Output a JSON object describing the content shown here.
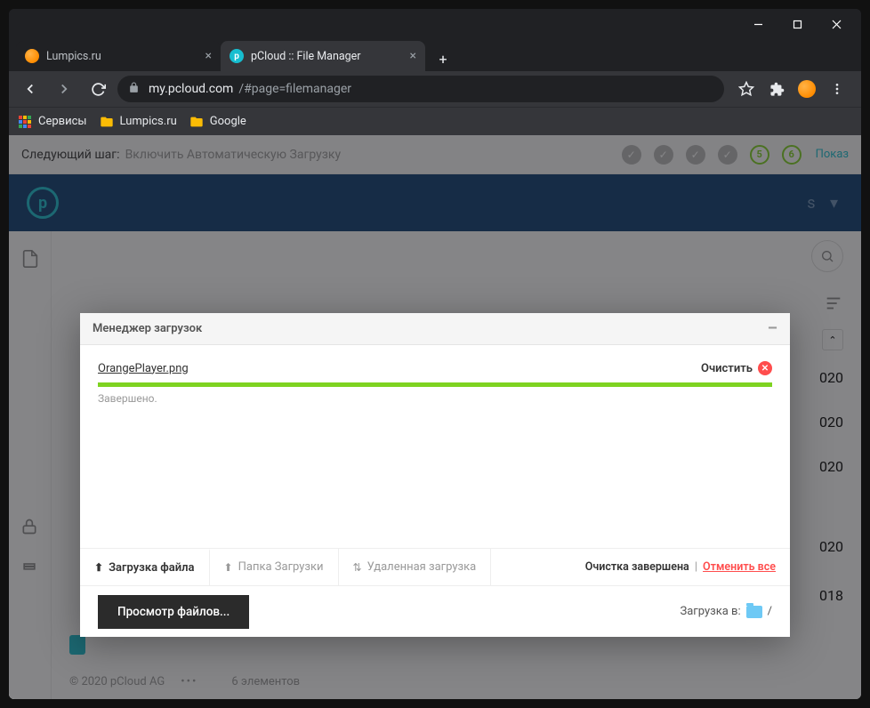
{
  "tabs": [
    {
      "title": "Lumpics.ru",
      "active": false,
      "favicon": "#ff8c00"
    },
    {
      "title": "pCloud :: File Manager",
      "active": true,
      "favicon": "#17bed0"
    }
  ],
  "url": {
    "host": "my.pcloud.com",
    "path": "/#page=filemanager"
  },
  "bookmarks": [
    {
      "label": "Сервисы",
      "type": "apps"
    },
    {
      "label": "Lumpics.ru",
      "type": "folder"
    },
    {
      "label": "Google",
      "type": "folder"
    }
  ],
  "banner": {
    "prefix": "Следующий шаг:",
    "hint": "Включить Автоматическую Загрузку",
    "step5": "5",
    "step6": "6",
    "show": "Показ"
  },
  "modal": {
    "title": "Менеджер загрузок",
    "file": "OrangePlayer.png",
    "clear": "Очистить",
    "status": "Завершено.",
    "tabs": {
      "upload_file": "Загрузка файла",
      "upload_folder": "Папка Загрузки",
      "remote_upload": "Удаленная загрузка"
    },
    "footer_status": {
      "done": "Очистка завершена",
      "cancel_all": "Отменить все"
    },
    "browse": "Просмотр файлов...",
    "dest_label": "Загрузка в:",
    "dest_path": "/"
  },
  "bg": {
    "dates": [
      "020",
      "020",
      "020",
      "020",
      "018"
    ],
    "elements": "6 элементов",
    "copyright": "© 2020 pCloud AG"
  }
}
